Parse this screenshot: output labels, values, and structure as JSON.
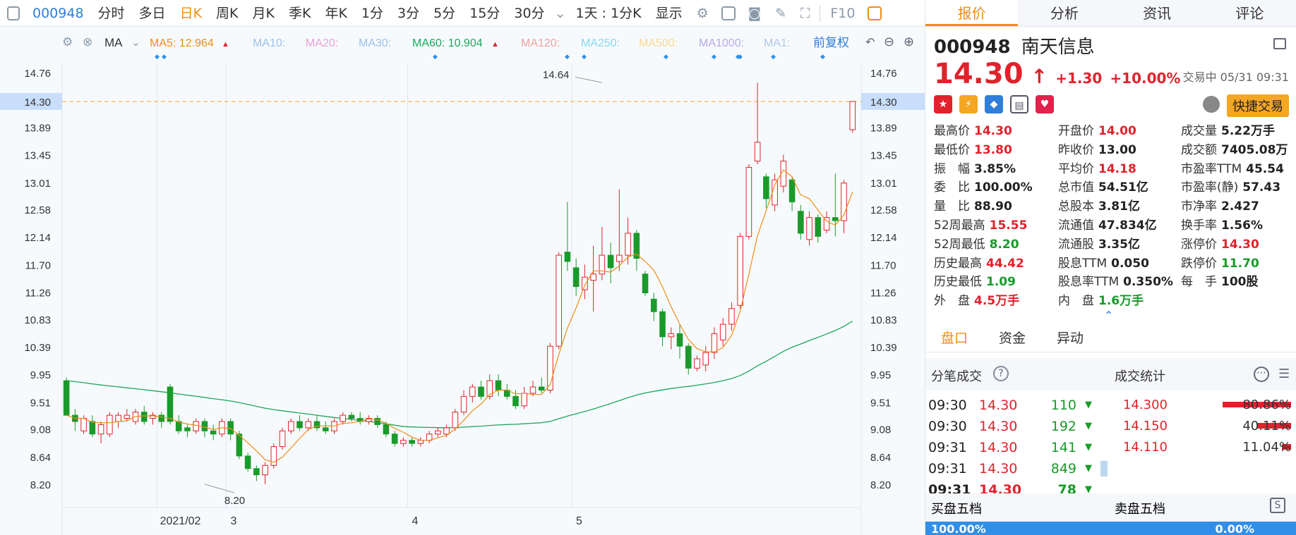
{
  "toolbar": {
    "code": "000948",
    "items": [
      "分时",
      "多日",
      "日K",
      "周K",
      "月K",
      "季K",
      "年K",
      "1分",
      "3分",
      "5分",
      "15分",
      "30分"
    ],
    "active_index": 2,
    "range_label": "1天 : 1分K",
    "show_label": "显示",
    "f10_label": "F10"
  },
  "ma_legend": {
    "ma_label": "MA",
    "items": [
      {
        "label": "MA5: 12.964",
        "color": "#f08c18",
        "arrow": "▲"
      },
      {
        "label": "MA10:",
        "color": "#9cc0e8",
        "arrow": ""
      },
      {
        "label": "MA20:",
        "color": "#e8a0d8",
        "arrow": ""
      },
      {
        "label": "MA30:",
        "color": "#9cc0e8",
        "arrow": ""
      },
      {
        "label": "MA60: 10.904",
        "color": "#1aa85a",
        "arrow": "▲"
      },
      {
        "label": "MA120:",
        "color": "#f0a0a0",
        "arrow": ""
      },
      {
        "label": "MA250:",
        "color": "#88d8f0",
        "arrow": ""
      },
      {
        "label": "MA500:",
        "color": "#f8d890",
        "arrow": ""
      },
      {
        "label": "MA1000:",
        "color": "#b8a8e8",
        "arrow": ""
      },
      {
        "label": "MA1:",
        "color": "#b0c8e8",
        "arrow": ""
      }
    ],
    "adjust_label": "前复权"
  },
  "chart_data": {
    "type": "candlestick",
    "y_ticks": [
      "14.76",
      "14.30",
      "13.89",
      "13.45",
      "13.01",
      "12.58",
      "12.14",
      "11.70",
      "11.26",
      "10.83",
      "10.39",
      "9.95",
      "9.51",
      "9.08",
      "8.64",
      "8.20"
    ],
    "y_range": [
      8.0,
      14.9
    ],
    "x_labels": [
      {
        "label": "2021/02",
        "index": 11
      },
      {
        "label": "3",
        "index": 19
      },
      {
        "label": "4",
        "index": 40
      },
      {
        "label": "5",
        "index": 59
      }
    ],
    "current_price": 14.3,
    "current_price_label": "14.30",
    "high_annotation": {
      "label": "14.64",
      "index": 62
    },
    "low_annotation": {
      "label": "8.20",
      "index": 16
    },
    "candles": [
      [
        9.85,
        9.3,
        9.9,
        9.3
      ],
      [
        9.3,
        9.2,
        9.4,
        9.05
      ],
      [
        9.05,
        9.25,
        9.3,
        9.0
      ],
      [
        9.2,
        9.0,
        9.3,
        8.95
      ],
      [
        9.0,
        9.15,
        9.2,
        8.85
      ],
      [
        9.0,
        9.3,
        9.35,
        8.95
      ],
      [
        9.2,
        9.3,
        9.35,
        9.1
      ],
      [
        9.25,
        9.3,
        9.4,
        9.2
      ],
      [
        9.2,
        9.35,
        9.4,
        9.15
      ],
      [
        9.35,
        9.2,
        9.45,
        9.15
      ],
      [
        9.25,
        9.3,
        9.35,
        9.15
      ],
      [
        9.3,
        9.2,
        9.35,
        9.1
      ],
      [
        9.75,
        9.2,
        9.8,
        9.15
      ],
      [
        9.2,
        9.05,
        9.3,
        9.0
      ],
      [
        9.1,
        9.05,
        9.15,
        8.95
      ],
      [
        9.05,
        9.2,
        9.25,
        9.0
      ],
      [
        9.2,
        9.05,
        9.25,
        8.95
      ],
      [
        9.05,
        9.0,
        9.15,
        8.9
      ],
      [
        9.0,
        9.2,
        9.25,
        8.95
      ],
      [
        9.2,
        9.0,
        9.25,
        8.9
      ],
      [
        9.0,
        8.65,
        9.05,
        8.6
      ],
      [
        8.65,
        8.45,
        8.7,
        8.4
      ],
      [
        8.45,
        8.35,
        8.5,
        8.25
      ],
      [
        8.35,
        8.5,
        8.55,
        8.2
      ],
      [
        8.5,
        8.8,
        8.85,
        8.45
      ],
      [
        8.8,
        9.05,
        9.1,
        8.75
      ],
      [
        9.05,
        9.2,
        9.25,
        9.0
      ],
      [
        9.2,
        9.1,
        9.3,
        9.05
      ],
      [
        9.1,
        9.2,
        9.25,
        9.05
      ],
      [
        9.2,
        9.1,
        9.3,
        9.05
      ],
      [
        9.1,
        9.05,
        9.2,
        9.0
      ],
      [
        9.05,
        9.2,
        9.25,
        9.0
      ],
      [
        9.2,
        9.3,
        9.35,
        9.15
      ],
      [
        9.3,
        9.25,
        9.35,
        9.2
      ],
      [
        9.25,
        9.2,
        9.35,
        9.15
      ],
      [
        9.2,
        9.25,
        9.3,
        9.15
      ],
      [
        9.25,
        9.15,
        9.3,
        9.1
      ],
      [
        9.15,
        9.0,
        9.2,
        8.95
      ],
      [
        9.0,
        8.85,
        9.05,
        8.8
      ],
      [
        8.85,
        8.9,
        8.95,
        8.8
      ],
      [
        8.9,
        8.85,
        8.95,
        8.8
      ],
      [
        8.85,
        8.9,
        8.95,
        8.8
      ],
      [
        8.9,
        9.0,
        9.05,
        8.85
      ],
      [
        9.0,
        9.05,
        9.1,
        8.95
      ],
      [
        9.0,
        9.1,
        9.15,
        8.95
      ],
      [
        9.1,
        9.35,
        9.4,
        9.05
      ],
      [
        9.35,
        9.6,
        9.7,
        9.3
      ],
      [
        9.6,
        9.75,
        9.8,
        9.5
      ],
      [
        9.75,
        9.6,
        9.85,
        9.55
      ],
      [
        9.6,
        9.85,
        9.95,
        9.55
      ],
      [
        9.85,
        9.7,
        9.95,
        9.6
      ],
      [
        9.7,
        9.6,
        9.8,
        9.55
      ],
      [
        9.6,
        9.45,
        9.7,
        9.4
      ],
      [
        9.45,
        9.65,
        9.75,
        9.4
      ],
      [
        9.65,
        9.75,
        9.85,
        9.6
      ],
      [
        9.75,
        9.7,
        9.9,
        9.65
      ],
      [
        9.7,
        10.4,
        10.45,
        9.65
      ],
      [
        10.4,
        11.85,
        11.9,
        10.35
      ],
      [
        11.9,
        11.75,
        12.7,
        11.6
      ],
      [
        11.65,
        11.35,
        11.8,
        11.2
      ],
      [
        11.3,
        11.5,
        11.7,
        11.15
      ],
      [
        11.45,
        11.55,
        12.0,
        10.95
      ],
      [
        11.55,
        11.85,
        12.3,
        11.45
      ],
      [
        11.85,
        11.65,
        12.05,
        11.4
      ],
      [
        11.75,
        11.85,
        12.9,
        11.6
      ],
      [
        11.85,
        12.2,
        12.45,
        11.7
      ],
      [
        12.2,
        11.8,
        12.25,
        11.6
      ],
      [
        11.55,
        11.25,
        11.6,
        11.2
      ],
      [
        11.15,
        10.95,
        11.25,
        10.8
      ],
      [
        10.95,
        10.55,
        11.0,
        10.4
      ],
      [
        10.55,
        10.6,
        10.7,
        10.35
      ],
      [
        10.6,
        10.4,
        10.75,
        10.2
      ],
      [
        10.4,
        10.05,
        10.45,
        9.95
      ],
      [
        10.05,
        10.2,
        10.25,
        10.0
      ],
      [
        10.1,
        10.3,
        10.4,
        10.0
      ],
      [
        10.3,
        10.6,
        10.7,
        10.2
      ],
      [
        10.5,
        10.75,
        10.85,
        10.4
      ],
      [
        10.75,
        11.0,
        11.1,
        10.65
      ],
      [
        11.05,
        12.15,
        12.2,
        11.0
      ],
      [
        12.15,
        13.25,
        13.3,
        12.1
      ],
      [
        13.35,
        13.65,
        14.6,
        13.3
      ],
      [
        13.1,
        12.75,
        13.15,
        12.6
      ],
      [
        12.65,
        13.05,
        13.15,
        12.55
      ],
      [
        12.95,
        13.35,
        13.45,
        12.85
      ],
      [
        13.05,
        12.7,
        13.1,
        12.55
      ],
      [
        12.55,
        12.2,
        12.65,
        12.1
      ],
      [
        12.1,
        12.45,
        12.55,
        12.0
      ],
      [
        12.45,
        12.15,
        12.5,
        12.05
      ],
      [
        12.25,
        12.45,
        12.55,
        12.2
      ],
      [
        12.45,
        12.4,
        13.15,
        12.15
      ],
      [
        12.4,
        13.0,
        13.05,
        12.2
      ],
      [
        13.85,
        14.3,
        14.3,
        13.8
      ]
    ]
  },
  "right_panel": {
    "tabs": [
      "报价",
      "分析",
      "资讯",
      "评论"
    ],
    "stock_code": "000948",
    "stock_name": "南天信息",
    "price": "14.30",
    "arrow": "↑",
    "change": "+1.30",
    "change_pct": "+10.00%",
    "status": "交易中 05/31 09:31",
    "fast_trade": "快捷交易",
    "stats": [
      {
        "k": "最高价",
        "v": "14.30",
        "c": "red"
      },
      {
        "k": "开盘价",
        "v": "14.00",
        "c": "red"
      },
      {
        "k": "成交量",
        "v": "5.22万手",
        "c": "dark"
      },
      {
        "k": "最低价",
        "v": "13.80",
        "c": "red"
      },
      {
        "k": "昨收价",
        "v": "13.00",
        "c": "dark"
      },
      {
        "k": "成交额",
        "v": "7405.08万",
        "c": "dark"
      },
      {
        "k": "振　幅",
        "v": "3.85%",
        "c": "dark"
      },
      {
        "k": "平均价",
        "v": "14.18",
        "c": "red"
      },
      {
        "k": "市盈率TTM",
        "v": "45.54",
        "c": "dark"
      },
      {
        "k": "委　比",
        "v": "100.00%",
        "c": "dark"
      },
      {
        "k": "总市值",
        "v": "54.51亿",
        "c": "dark"
      },
      {
        "k": "市盈率(静)",
        "v": "57.43",
        "c": "dark"
      },
      {
        "k": "量　比",
        "v": "88.90",
        "c": "dark"
      },
      {
        "k": "总股本",
        "v": "3.81亿",
        "c": "dark"
      },
      {
        "k": "市净率",
        "v": "2.427",
        "c": "dark"
      },
      {
        "k": "52周最高",
        "v": "15.55",
        "c": "red"
      },
      {
        "k": "流通值",
        "v": "47.834亿",
        "c": "dark"
      },
      {
        "k": "换手率",
        "v": "1.56%",
        "c": "dark"
      },
      {
        "k": "52周最低",
        "v": "8.20",
        "c": "green"
      },
      {
        "k": "流通股",
        "v": "3.35亿",
        "c": "dark"
      },
      {
        "k": "涨停价",
        "v": "14.30",
        "c": "red"
      },
      {
        "k": "历史最高",
        "v": "44.42",
        "c": "red"
      },
      {
        "k": "股息TTM",
        "v": "0.050",
        "c": "dark"
      },
      {
        "k": "跌停价",
        "v": "11.70",
        "c": "green"
      },
      {
        "k": "历史最低",
        "v": "1.09",
        "c": "green"
      },
      {
        "k": "股息率TTM",
        "v": "0.350%",
        "c": "dark"
      },
      {
        "k": "每　手",
        "v": "100股",
        "c": "dark"
      },
      {
        "k": "外　盘",
        "v": "4.5万手",
        "c": "red"
      },
      {
        "k": "内　盘",
        "v": "1.6万手",
        "c": "green"
      },
      {
        "k": "",
        "v": "",
        "c": "dark"
      }
    ],
    "sub_tabs": [
      "盘口",
      "资金",
      "异动"
    ],
    "ticks_title": "分笔成交",
    "stats_title": "成交统计",
    "ticks": [
      {
        "time": "09:30",
        "price": "14.30",
        "vol": "110"
      },
      {
        "time": "09:30",
        "price": "14.30",
        "vol": "192"
      },
      {
        "time": "09:31",
        "price": "14.30",
        "vol": "141"
      },
      {
        "time": "09:31",
        "price": "14.30",
        "vol": "849"
      },
      {
        "time": "09:31",
        "price": "14.30",
        "vol": "78"
      }
    ],
    "vol_stats": [
      {
        "price": "14.300",
        "pct": "80.86%",
        "fill": 0.8086
      },
      {
        "price": "14.150",
        "pct": "40.11%",
        "fill": 0.4011
      },
      {
        "price": "14.110",
        "pct": "11.04%",
        "fill": 0.1104
      }
    ],
    "buy_book": "买盘五档",
    "sell_book": "卖盘五档",
    "buy_pct": "100.00%",
    "sell_pct": "0.00%"
  }
}
